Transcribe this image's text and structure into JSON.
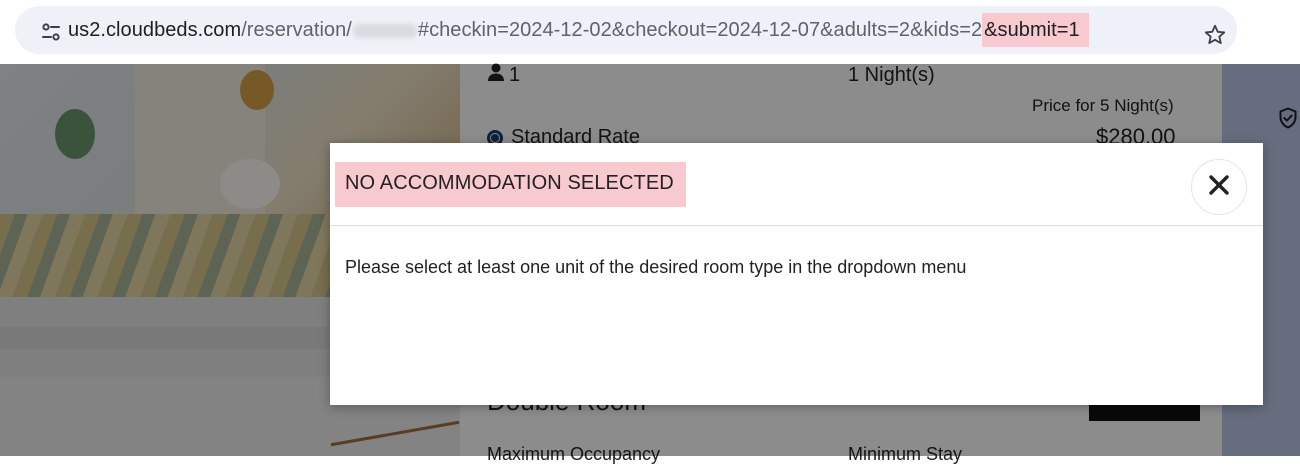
{
  "browser": {
    "url_host": "us2.cloudbeds.com",
    "url_path": "/reservation/",
    "url_query": "#checkin=2024-12-02&checkout=2024-12-07&adults=2&kids=2",
    "url_highlight": "&submit=1"
  },
  "background_page": {
    "occupancy_count": "1",
    "nights_label": "1 Night(s)",
    "price_for_label": "Price for 5 Night(s)",
    "rate_name": "Standard Rate",
    "rate_price": "$280.00",
    "room_name": "Double Room",
    "max_occupancy_label": "Maximum Occupancy",
    "min_stay_label": "Minimum Stay"
  },
  "modal": {
    "title": "NO ACCOMMODATION SELECTED",
    "message": "Please select at least one unit of the desired room type in the dropdown menu"
  },
  "colors": {
    "highlight": "#f8c9ce",
    "overlay": "rgba(0,0,0,0.45)",
    "sidebar": "#b8c6e5"
  }
}
